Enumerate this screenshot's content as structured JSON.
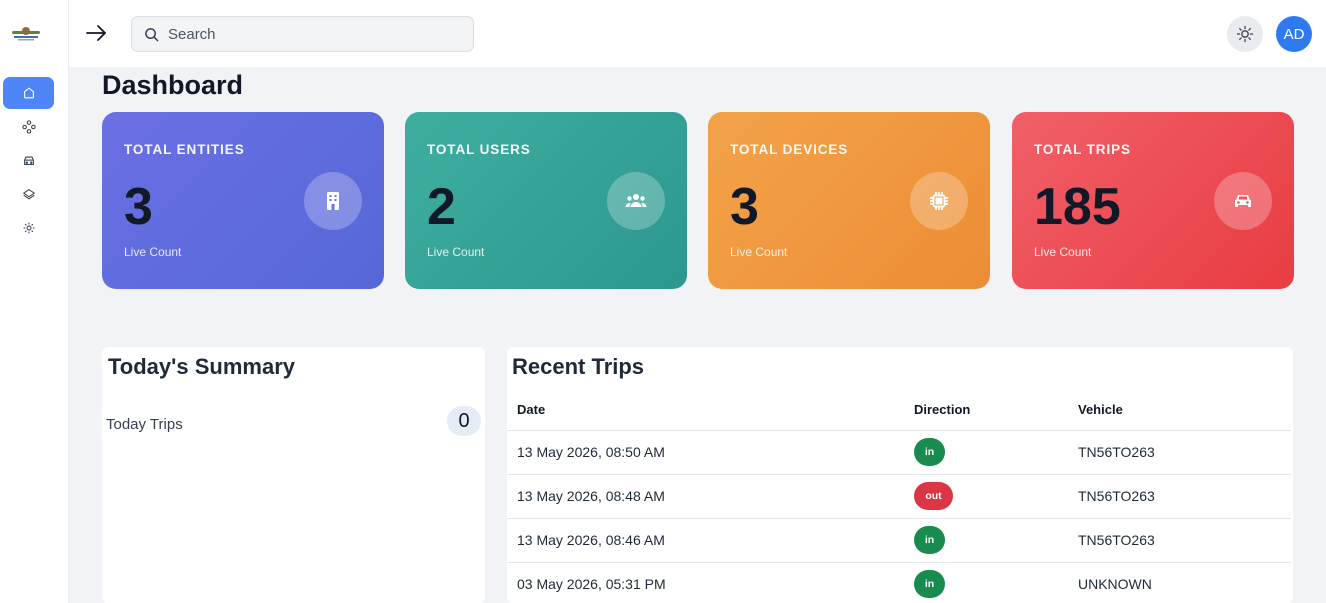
{
  "sidebar": {
    "logo": "logo",
    "items": [
      {
        "icon": "home-icon",
        "active": true
      },
      {
        "icon": "nodes-icon",
        "active": false
      },
      {
        "icon": "car-icon",
        "active": false
      },
      {
        "icon": "layers-icon",
        "active": false
      },
      {
        "icon": "gear-icon",
        "active": false
      }
    ]
  },
  "topbar": {
    "search_placeholder": "Search",
    "avatar_initials": "AD"
  },
  "page_title": "Dashboard",
  "cards": [
    {
      "title": "TOTAL ENTITIES",
      "value": "3",
      "sub": "Live Count",
      "icon": "building-icon"
    },
    {
      "title": "TOTAL USERS",
      "value": "2",
      "sub": "Live Count",
      "icon": "users-icon"
    },
    {
      "title": "TOTAL DEVICES",
      "value": "3",
      "sub": "Live Count",
      "icon": "chip-icon"
    },
    {
      "title": "TOTAL TRIPS",
      "value": "185",
      "sub": "Live Count",
      "icon": "car-icon"
    }
  ],
  "summary": {
    "title": "Today's Summary",
    "row_label": "Today Trips",
    "row_value": "0"
  },
  "recent_trips": {
    "title": "Recent Trips",
    "columns": [
      "Date",
      "Direction",
      "Vehicle"
    ],
    "rows": [
      {
        "date": "13 May 2026, 08:50 AM",
        "direction": "in",
        "vehicle": "TN56TO263"
      },
      {
        "date": "13 May 2026, 08:48 AM",
        "direction": "out",
        "vehicle": "TN56TO263"
      },
      {
        "date": "13 May 2026, 08:46 AM",
        "direction": "in",
        "vehicle": "TN56TO263"
      },
      {
        "date": "03 May 2026, 05:31 PM",
        "direction": "in",
        "vehicle": "UNKNOWN"
      }
    ]
  },
  "colors": {
    "accent": "#2f7af0",
    "sidebar_active": "#4f86f7",
    "entities": "#5f6be0",
    "users": "#34a297",
    "devices": "#f0983e",
    "trips": "#ec4a50",
    "direction_in": "#1a8b4e",
    "direction_out": "#dc3545"
  }
}
